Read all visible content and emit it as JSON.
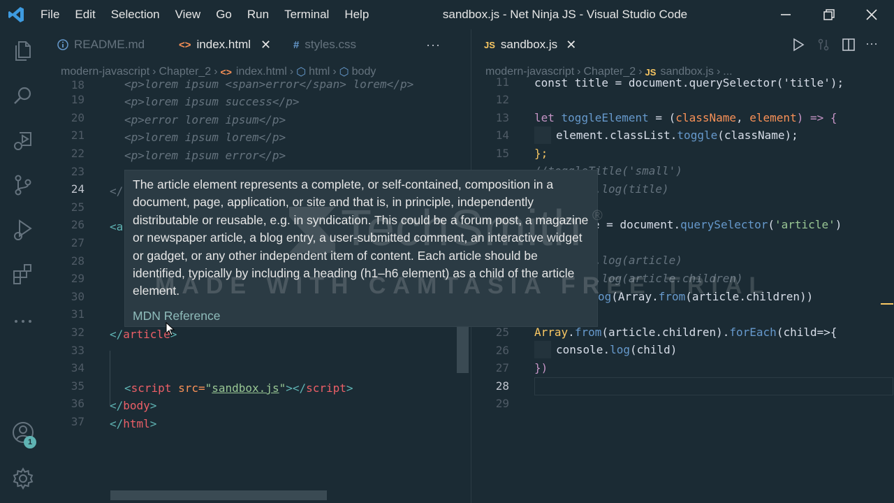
{
  "app": {
    "window_title": "sandbox.js - Net Ninja JS - Visual Studio Code",
    "menu": [
      "File",
      "Edit",
      "Selection",
      "View",
      "Go",
      "Run",
      "Terminal",
      "Help"
    ],
    "accounts_badge": "1"
  },
  "left_pane": {
    "tabs": [
      {
        "label": "README.md",
        "icon": "info-icon"
      },
      {
        "label": "index.html",
        "icon": "html-icon",
        "active": true
      },
      {
        "label": "styles.css",
        "icon": "hash-icon"
      }
    ],
    "more_label": "···",
    "breadcrumb": [
      "modern-javascript",
      "Chapter_2",
      "index.html",
      "html",
      "body"
    ],
    "line_numbers": [
      "18",
      "19",
      "20",
      "21",
      "22",
      "23",
      "24",
      "25",
      "26",
      "27",
      "28",
      "29",
      "30",
      "31",
      "32",
      "33",
      "34",
      "35",
      "36",
      "37"
    ],
    "current_line": "24",
    "lines": {
      "l18": "<p>lorem ipsum <span>error</span> lorem</p>",
      "l19": "<p>lorem ipsum success</p>",
      "l20": "<p>error lorem ipsum</p>",
      "l21": "<p>lorem ipsum lorem</p>",
      "l22": "<p>lorem ipsum error</p>",
      "l24_open": "</",
      "l26_open": "<a",
      "l32_lt": "</",
      "l32_tag": "article",
      "l32_gt": ">",
      "l35_open": "<",
      "l35_tag": "script",
      "l35_attr": " src=",
      "l35_q1": "\"",
      "l35_val": "sandbox.js",
      "l35_q2": "\"",
      "l35_close": "></",
      "l35_tag2": "script",
      "l35_gt": ">",
      "l36_lt": "</",
      "l36_tag": "body",
      "l36_gt": ">",
      "l37_lt": "</",
      "l37_tag": "html",
      "l37_gt": ">"
    }
  },
  "hover": {
    "text": "The article element represents a complete, or self-contained, composition in a document, page, application, or site and that is, in principle, independently distributable or reusable, e.g. in syndication. This could be a forum post, a magazine or newspaper article, a blog entry, a user-submitted comment, an interactive widget or gadget, or any other independent item of content. Each article should be identified, typically by including a heading (h1–h6 element) as a child of the article element.",
    "link": "MDN Reference"
  },
  "right_pane": {
    "tab": {
      "label": "sandbox.js",
      "icon_text": "JS"
    },
    "breadcrumb": [
      "modern-javascript",
      "Chapter_2",
      "sandbox.js",
      "..."
    ],
    "breadcrumb_icon_text": "JS",
    "line_numbers": [
      "11",
      "12",
      "13",
      "14",
      "15",
      "",
      "",
      "",
      "",
      "",
      "",
      "",
      "",
      "",
      "25",
      "26",
      "27",
      "28",
      "29"
    ],
    "current_line": "28",
    "lines": {
      "l11": "const title = document.querySelector('title');",
      "l13_let": "let",
      "l13_name": " toggleElement",
      "l13_eq": " = (",
      "l13_p1": "className",
      "l13_comma": ", ",
      "l13_p2": "element",
      "l13_arrow": ") => {",
      "l14_obj": "element",
      "l14_dot1": ".",
      "l14_prop": "classList",
      "l14_dot2": ".",
      "l14_fn": "toggle",
      "l14_args": "(className);",
      "l15": "};",
      "l16": "//toggleTitle('small')",
      "l17": "//console.log(title)",
      "l19_a": "icle = ",
      "l19_b": "document",
      "l19_c": ".",
      "l19_d": "querySelector",
      "l19_e": "(",
      "l19_f": "'article'",
      "l19_g": ")",
      "l21": "//console.log(article)",
      "l22": "//console.log(article.children)",
      "l24_fn": "og",
      "l24_p": "(",
      "l24_arr": "Array",
      "l24_dot": ".",
      "l24_from": "from",
      "l24_rest": "(article.children))",
      "l25_arr": "Array",
      "l25_dot": ".",
      "l25_from": "from",
      "l25_args": "(article.children).",
      "l25_fe": "forEach",
      "l25_rest": "(child=>{",
      "l26_con": "console",
      "l26_dot": ".",
      "l26_log": "log",
      "l26_args": "(child)",
      "l27": "})"
    }
  },
  "watermark": {
    "brand": "TechSmith",
    "reg": "®",
    "tagline": "MADE WITH CAMTASIA FREE TRIAL"
  },
  "colors": {
    "background": "#1b2b34",
    "keyword": "#c594c5",
    "function": "#6699cc",
    "string": "#99c794",
    "tag": "#ec5f67",
    "attr": "#f99157",
    "comment": "#65737e",
    "text": "#d8dee9"
  }
}
